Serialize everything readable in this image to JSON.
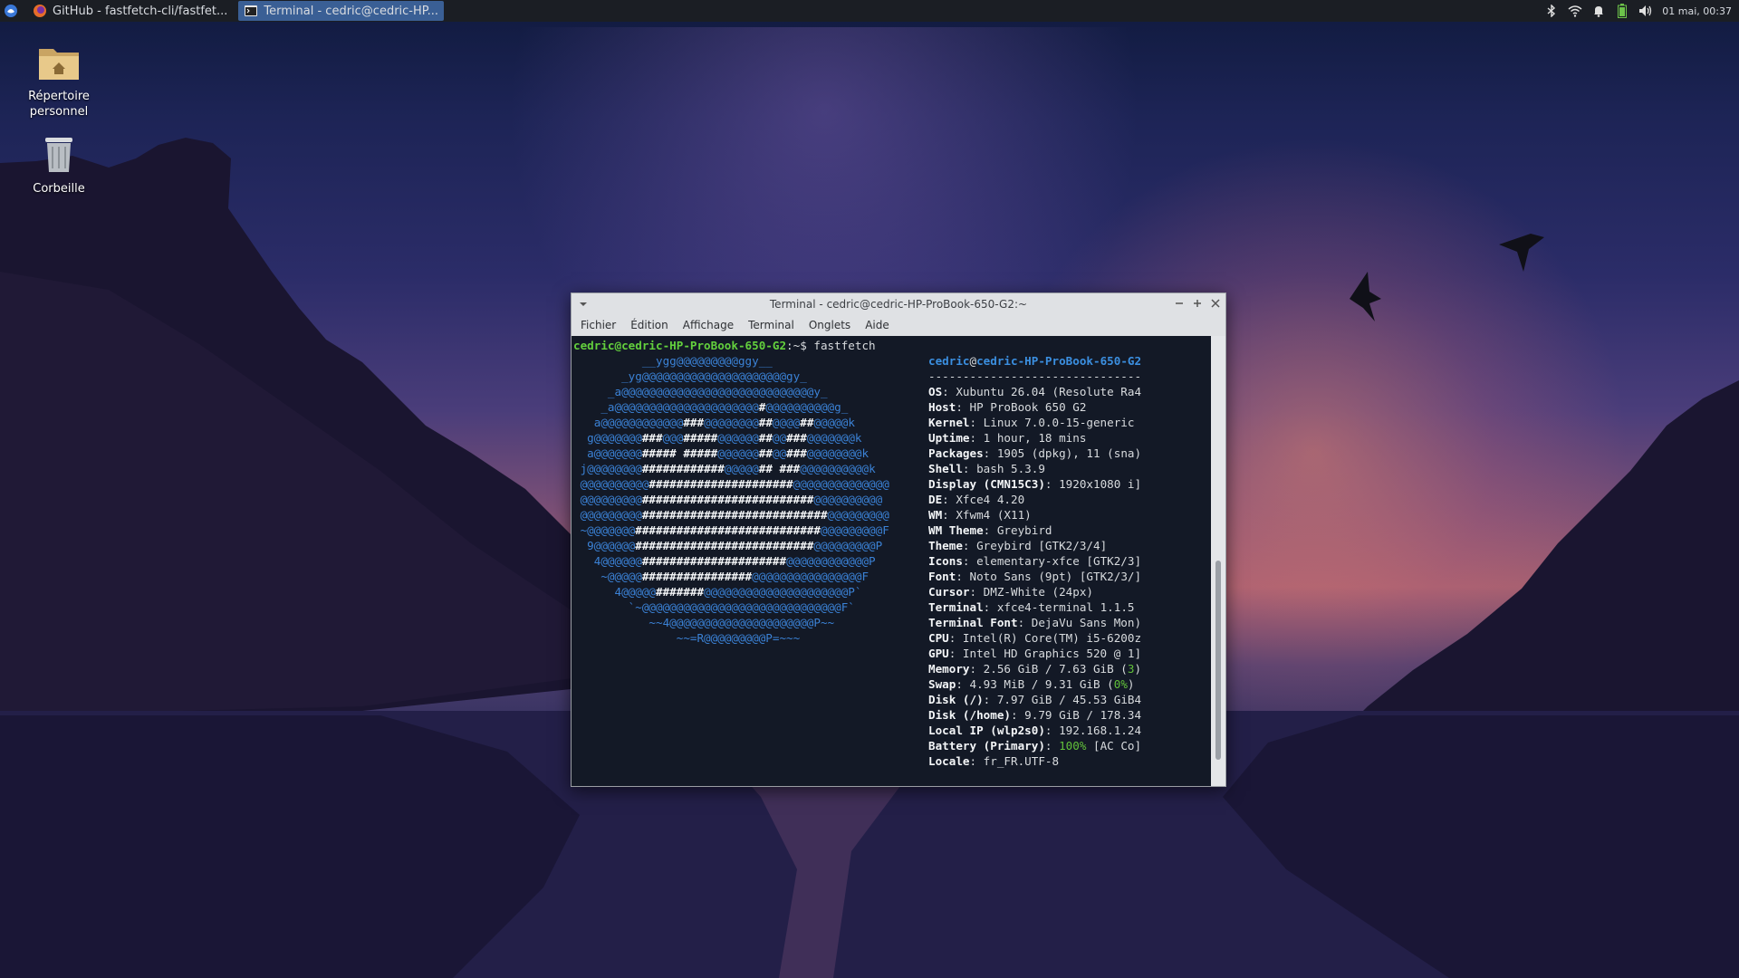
{
  "taskbar": {
    "tasks": [
      {
        "label": "GitHub - fastfetch-cli/fastfet...",
        "icon": "firefox-icon",
        "active": false
      },
      {
        "label": "Terminal - cedric@cedric-HP...",
        "icon": "terminal-icon",
        "active": true
      }
    ],
    "clock": "01 mai, 00:37"
  },
  "desktop": {
    "icons": [
      {
        "label": "Répertoire personnel",
        "icon": "home-folder-icon"
      },
      {
        "label": "Corbeille",
        "icon": "trash-icon"
      }
    ]
  },
  "terminal": {
    "title": "Terminal - cedric@cedric-HP-ProBook-650-G2:~",
    "menu": [
      "Fichier",
      "Édition",
      "Affichage",
      "Terminal",
      "Onglets",
      "Aide"
    ],
    "prompt_user": "cedric@cedric-HP-ProBook-650-G2",
    "prompt_path": ":~$ ",
    "command": "fastfetch",
    "info_user": "cedric",
    "info_at": "@",
    "info_host": "cedric-HP-ProBook-650-G2",
    "separator": "-------------------------------",
    "art_lines": [
      "          __ygg@@@@@@@@@ggy__",
      "       _yg@@@@@@@@@@@@@@@@@@@@@gy_",
      "     _a@@@@@@@@@@@@@@@@@@@@@@@@@@@@y_",
      "    _a@@@@@@@@@@@@@@@@@@@@@[#]@@@@@@@@@@g_",
      "   a@@@@@@@@@@@@[###]@@@@@@@@[##]@@@@[##]@@@@@k",
      "  g@@@@@@@[###]@@@[#####]@@@@@@[##]@@[###]@@@@@@@k",
      "  a@@@@@@@[#####][ ][#####]@@@@@@[##]@@[###]@@@@@@@@k",
      " j@@@@@@@@[############]@@@@@[##][ ][###]@@@@@@@@@@k",
      " @@@@@@@@@@[#####################]@@@@@@@@@@@@@@",
      " @@@@@@@@@[#########################]@@@@@@@@@@",
      " @@@@@@@@@[###########################]@@@@@@@@@",
      " ~@@@@@@@[###########################]@@@@@@@@@F",
      "  9@@@@@@[##########################]@@@@@@@@@P",
      "   4@@@@@@[#####################]@@@@@@@@@@@@P",
      "    ~@@@@@[################]@@@@@@@@@@@@@@@@F",
      "      4@@@@@[#######]@@@@@@@@@@@@@@@@@@@@@P`",
      "        `~@@@@@@@@@@@@@@@@@@@@@@@@@@@@@F`",
      "           ~~4@@@@@@@@@@@@@@@@@@@@@P~~",
      "               ~~=R@@@@@@@@@P=~~~"
    ],
    "info_lines": [
      {
        "key": "OS",
        "value": "Xubuntu 26.04 (Resolute Ra4"
      },
      {
        "key": "Host",
        "value": "HP ProBook 650 G2"
      },
      {
        "key": "Kernel",
        "value": "Linux 7.0.0-15-generic"
      },
      {
        "key": "Uptime",
        "value": "1 hour, 18 mins"
      },
      {
        "key": "Packages",
        "value": "1905 (dpkg), 11 (sna)"
      },
      {
        "key": "Shell",
        "value": "bash 5.3.9"
      },
      {
        "key": "Display (CMN15C3)",
        "value": "1920x1080 i]"
      },
      {
        "key": "DE",
        "value": "Xfce4 4.20"
      },
      {
        "key": "WM",
        "value": "Xfwm4 (X11)"
      },
      {
        "key": "WM Theme",
        "value": "Greybird"
      },
      {
        "key": "Theme",
        "value": "Greybird [GTK2/3/4]"
      },
      {
        "key": "Icons",
        "value": "elementary-xfce [GTK2/3]"
      },
      {
        "key": "Font",
        "value": "Noto Sans (9pt) [GTK2/3/]"
      },
      {
        "key": "Cursor",
        "value": "DMZ-White (24px)"
      },
      {
        "key": "Terminal",
        "value": "xfce4-terminal 1.1.5"
      },
      {
        "key": "Terminal Font",
        "value": "DejaVu Sans Mon)"
      },
      {
        "key": "CPU",
        "value": "Intel(R) Core(TM) i5-6200z"
      },
      {
        "key": "GPU",
        "value": "Intel HD Graphics 520 @ 1]"
      },
      {
        "key": "Memory",
        "value": "2.56 GiB / 7.63 GiB (",
        "hl": "3",
        "tail": ")"
      },
      {
        "key": "Swap",
        "value": "4.93 MiB / 9.31 GiB (",
        "hl": "0%",
        "tail": ")"
      },
      {
        "key": "Disk (/)",
        "value": "7.97 GiB / 45.53 GiB4"
      },
      {
        "key": "Disk (/home)",
        "value": "9.79 GiB / 178.34"
      },
      {
        "key": "Local IP (wlp2s0)",
        "value": "192.168.1.24"
      },
      {
        "key": "Battery (Primary)",
        "value": "",
        "hl": "100%",
        "tail": " [AC Co]"
      },
      {
        "key": "Locale",
        "value": "fr_FR.UTF-8"
      }
    ]
  }
}
